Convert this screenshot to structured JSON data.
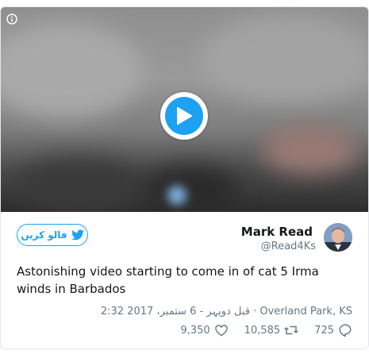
{
  "video": {
    "info_icon": "info-icon",
    "play_icon": "play-icon",
    "accent": "#1da1f2"
  },
  "author": {
    "name": "Mark Read",
    "handle": "@Read4Ks",
    "avatar": "avatar-photo"
  },
  "follow": {
    "label": "فالو کریں",
    "icon": "twitter-bird-icon"
  },
  "tweet": {
    "text": "Astonishing video starting to come in of cat 5 Irma winds in Barbados"
  },
  "meta": {
    "text": "2:32 قبل دوپہر - 6 ستمبر، 2017 · Overland Park, KS"
  },
  "actions": {
    "likes": "9,350",
    "retweets": "10,585",
    "replies": "725"
  }
}
